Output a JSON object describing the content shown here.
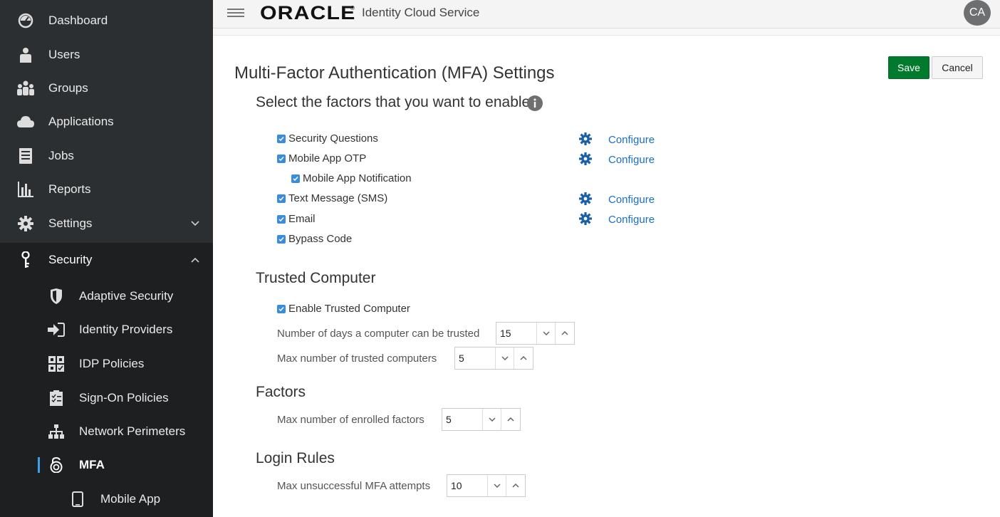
{
  "sidebar": {
    "items": [
      {
        "label": "Dashboard",
        "icon": "dashboard-icon"
      },
      {
        "label": "Users",
        "icon": "user-icon"
      },
      {
        "label": "Groups",
        "icon": "groups-icon"
      },
      {
        "label": "Applications",
        "icon": "cloud-icon"
      },
      {
        "label": "Jobs",
        "icon": "jobs-icon"
      },
      {
        "label": "Reports",
        "icon": "bar-chart-icon"
      },
      {
        "label": "Settings",
        "icon": "gear-icon"
      },
      {
        "label": "Security",
        "icon": "key-icon"
      }
    ],
    "security_items": [
      {
        "label": "Adaptive Security",
        "icon": "shield-icon"
      },
      {
        "label": "Identity Providers",
        "icon": "sign-in-icon"
      },
      {
        "label": "IDP Policies",
        "icon": "idp-policy-icon"
      },
      {
        "label": "Sign-On Policies",
        "icon": "checklist-icon"
      },
      {
        "label": "Network Perimeters",
        "icon": "network-icon"
      },
      {
        "label": "MFA",
        "icon": "mfa-lock-icon"
      },
      {
        "label": "Mobile App",
        "icon": "mobile-phone-icon"
      }
    ],
    "active_color": "#3fa0ea"
  },
  "header": {
    "brand": "ORACLE",
    "brand_mark": "®",
    "service": "Identity Cloud Service",
    "avatar": "CA"
  },
  "main": {
    "title": "Multi-Factor Authentication (MFA) Settings",
    "save_label": "Save",
    "cancel_label": "Cancel",
    "factors_prompt": "Select the factors that you want to enable:",
    "factors": [
      {
        "label": "Security Questions",
        "checked": true,
        "configure": "Configure"
      },
      {
        "label": "Mobile App OTP",
        "checked": true,
        "configure": "Configure"
      },
      {
        "label": "Mobile App Notification",
        "checked": true
      },
      {
        "label": "Text Message (SMS)",
        "checked": true,
        "configure": "Configure"
      },
      {
        "label": "Email",
        "checked": true,
        "configure": "Configure"
      },
      {
        "label": "Bypass Code",
        "checked": true
      }
    ],
    "trusted_computer": {
      "heading": "Trusted Computer",
      "enable_label": "Enable Trusted Computer",
      "days_label": "Number of days a computer can be trusted",
      "days_value": "15",
      "max_label": "Max number of trusted computers",
      "max_value": "5"
    },
    "factors_section": {
      "heading": "Factors",
      "enrolled_label": "Max number of enrolled factors",
      "enrolled_value": "5"
    },
    "login_rules": {
      "heading": "Login Rules",
      "attempts_label": "Max unsuccessful MFA attempts",
      "attempts_value": "10"
    },
    "accent_color": "#007b2e",
    "link_color": "#1a6fc4"
  }
}
